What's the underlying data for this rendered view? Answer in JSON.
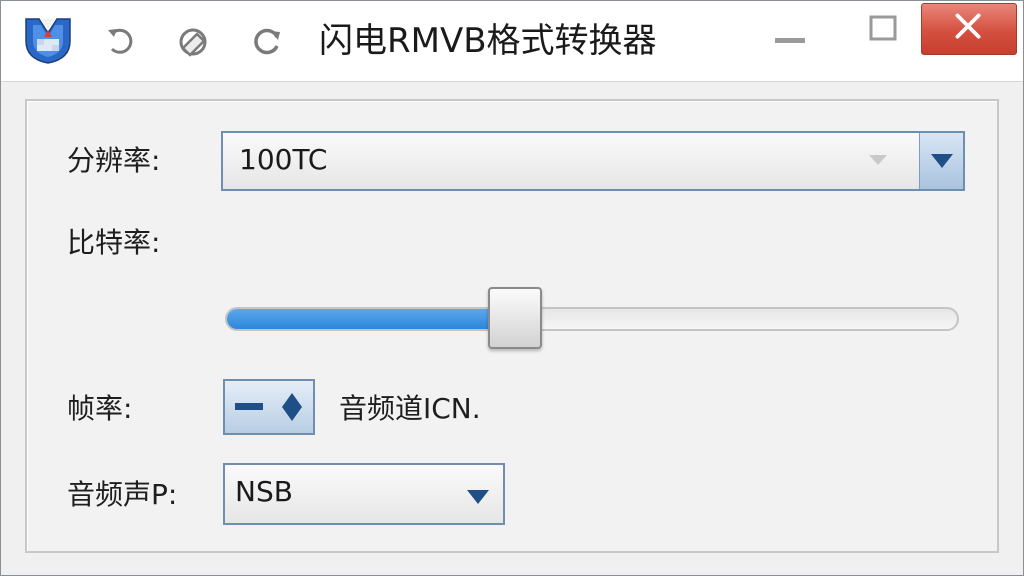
{
  "window": {
    "title": "闪电RMVB格式转换器",
    "icons": [
      "app-logo-icon",
      "undo-icon",
      "eraser-icon",
      "refresh-icon",
      "minimize-icon",
      "maximize-icon",
      "close-icon"
    ]
  },
  "form": {
    "resolution": {
      "label": "分辨率:",
      "value": "100TC"
    },
    "bitrate": {
      "label": "比特率:",
      "level": 0.395
    },
    "framerate": {
      "label": "帧率:",
      "trailing_text": "音频道ICN."
    },
    "audio": {
      "label": "音频声P:",
      "value": "NSB"
    }
  },
  "colors": {
    "accent": "#2d86db",
    "close_button": "#d4503f",
    "control_border": "#6f8fb0"
  }
}
